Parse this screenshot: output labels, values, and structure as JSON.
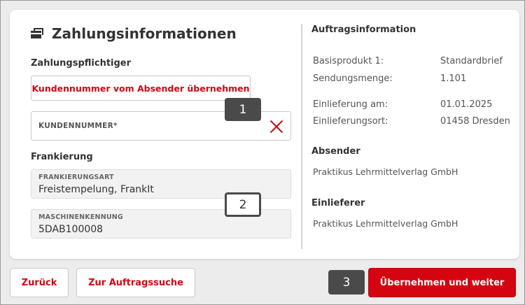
{
  "header": {
    "title": "Zahlungsinformationen"
  },
  "payer": {
    "label": "Zahlungspflichtiger",
    "copy_button": "Kundennummer vom Absender übernehmen",
    "customer_number_placeholder": "KUNDENNUMMER*",
    "customer_number_value": ""
  },
  "franking": {
    "label": "Frankierung",
    "type_caption": "FRANKIERUNGSART",
    "type_value": "Freistempelung, FrankIt",
    "machine_caption": "MASCHINENKENNUNG",
    "machine_value": "5DAB100008"
  },
  "badges": {
    "one": "1",
    "two": "2",
    "three": "3"
  },
  "order_info": {
    "title": "Auftragsinformation",
    "rows": [
      {
        "key": "Basisprodukt 1:",
        "value": "Standardbrief"
      },
      {
        "key": "Sendungsmenge:",
        "value": "1.101"
      },
      {
        "key": "Einlieferung am:",
        "value": "01.01.2025"
      },
      {
        "key": "Einlieferungsort:",
        "value": "01458 Dresden"
      }
    ],
    "sender_title": "Absender",
    "sender_value": "Praktikus Lehrmittelverlag GmbH",
    "deliverer_title": "Einlieferer",
    "deliverer_value": "Praktikus Lehrmittelverlag GmbH"
  },
  "footer": {
    "back": "Zurück",
    "order_search": "Zur Auftragssuche",
    "submit": "Übernehmen und weiter"
  },
  "colors": {
    "accent": "#d40511",
    "badge": "#4a4a4a"
  },
  "icons": {
    "title": "wallet-icon",
    "clear": "close-icon"
  }
}
